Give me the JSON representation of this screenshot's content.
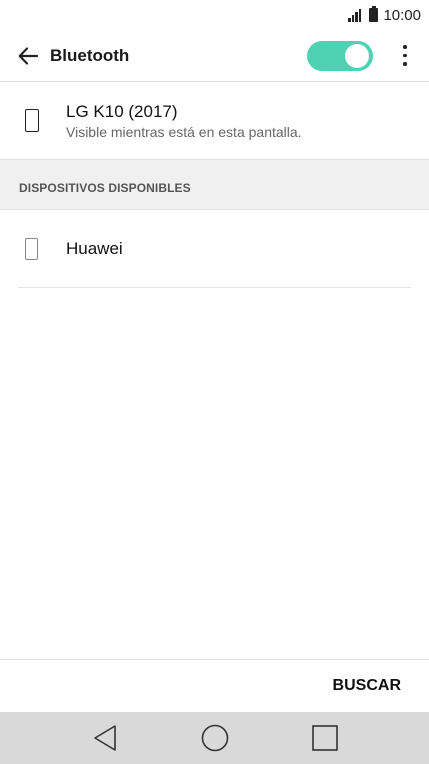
{
  "status": {
    "time": "10:00"
  },
  "header": {
    "title": "Bluetooth",
    "toggle_on": true,
    "toggle_color": "#4fd1b4"
  },
  "own_device": {
    "name": "LG K10 (2017)",
    "subtitle": "Visible mientras está en esta pantalla."
  },
  "available": {
    "header": "DISPOSITIVOS DISPONIBLES",
    "devices": [
      {
        "name": "Huawei",
        "icon": "phone-icon"
      }
    ]
  },
  "footer": {
    "scan_label": "BUSCAR"
  },
  "nav": {
    "icons": [
      "back-triangle-icon",
      "home-circle-icon",
      "recents-square-icon"
    ]
  }
}
